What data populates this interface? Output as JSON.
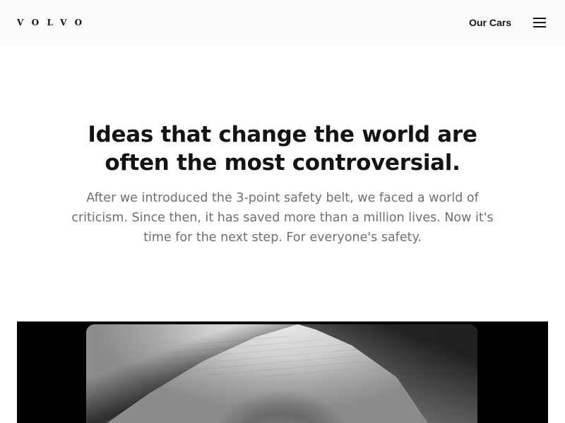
{
  "header": {
    "logo_text": "VOLVO",
    "nav_link": "Our Cars",
    "menu_icon": "hamburger-menu-icon"
  },
  "main": {
    "headline": "Ideas that change the world are often the most controversial.",
    "intro": "After we introduced the 3-point safety belt, we faced a world of criticism. Since then, it has saved more than a million lives. Now it's time for the next step. For everyone's safety."
  },
  "hero": {
    "image": "black-and-white-portrait-photo"
  },
  "colors": {
    "topbar_bg": "#fafafa",
    "text_primary": "#141414",
    "text_secondary": "#707070",
    "hero_bg": "#000000"
  }
}
